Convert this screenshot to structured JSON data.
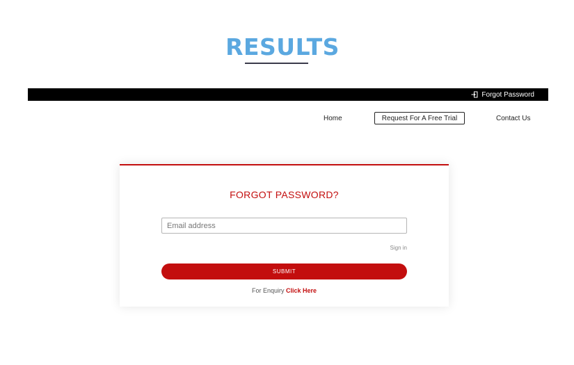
{
  "header": {
    "title": "RESULTS"
  },
  "top_bar": {
    "forgot_password_link": "Forgot Password",
    "icon": "sign-in-icon"
  },
  "nav": {
    "home": "Home",
    "free_trial": "Request For A Free Trial",
    "contact": "Contact Us"
  },
  "form": {
    "title": "FORGOT PASSWORD?",
    "email_placeholder": "Email address",
    "email_value": "",
    "sign_in_link": "Sign in",
    "submit_label": "SUBMIT",
    "enquiry_text": "For Enquiry",
    "enquiry_link": "Click Here"
  },
  "colors": {
    "title_blue": "#5ba8e0",
    "brand_red": "#c30e0e",
    "top_bar": "#000000"
  }
}
